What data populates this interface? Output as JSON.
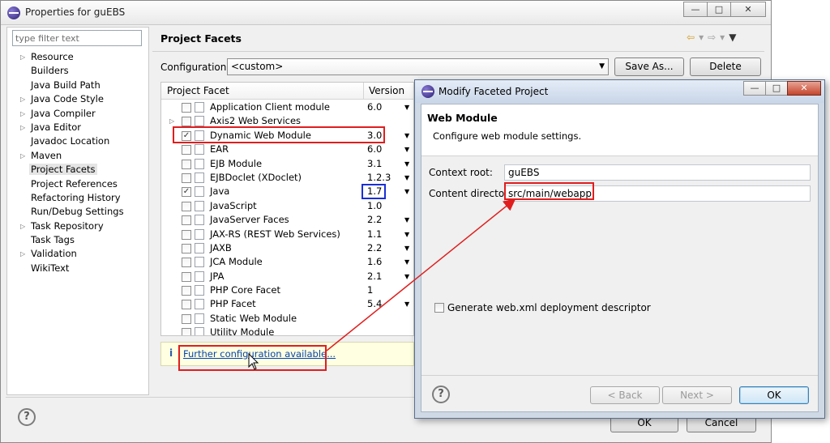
{
  "main_window": {
    "title": "Properties for guEBS",
    "controls": {
      "minimize": "—",
      "maximize": "□",
      "close": "✕"
    },
    "filter_placeholder": "type filter text",
    "nav": [
      {
        "label": "Resource",
        "expandable": true
      },
      {
        "label": "Builders",
        "expandable": false
      },
      {
        "label": "Java Build Path",
        "expandable": false
      },
      {
        "label": "Java Code Style",
        "expandable": true
      },
      {
        "label": "Java Compiler",
        "expandable": true
      },
      {
        "label": "Java Editor",
        "expandable": true
      },
      {
        "label": "Javadoc Location",
        "expandable": false
      },
      {
        "label": "Maven",
        "expandable": true
      },
      {
        "label": "Project Facets",
        "expandable": false,
        "selected": true
      },
      {
        "label": "Project References",
        "expandable": false
      },
      {
        "label": "Refactoring History",
        "expandable": false
      },
      {
        "label": "Run/Debug Settings",
        "expandable": false
      },
      {
        "label": "Task Repository",
        "expandable": true
      },
      {
        "label": "Task Tags",
        "expandable": false
      },
      {
        "label": "Validation",
        "expandable": true
      },
      {
        "label": "WikiText",
        "expandable": false
      }
    ],
    "page_title": "Project Facets",
    "configuration_label": "Configuration:",
    "configuration_value": "<custom>",
    "save_as_label": "Save As...",
    "delete_label": "Delete",
    "table_headers": {
      "facet": "Project Facet",
      "version": "Version"
    },
    "facets": [
      {
        "name": "Application Client module",
        "version": "6.0",
        "checked": false,
        "has_dropdown": true,
        "expander": false
      },
      {
        "name": "Axis2 Web Services",
        "version": "",
        "checked": false,
        "has_dropdown": false,
        "expander": true
      },
      {
        "name": "Dynamic Web Module",
        "version": "3.0",
        "checked": true,
        "has_dropdown": true,
        "expander": false
      },
      {
        "name": "EAR",
        "version": "6.0",
        "checked": false,
        "has_dropdown": true,
        "expander": false
      },
      {
        "name": "EJB Module",
        "version": "3.1",
        "checked": false,
        "has_dropdown": true,
        "expander": false
      },
      {
        "name": "EJBDoclet (XDoclet)",
        "version": "1.2.3",
        "checked": false,
        "has_dropdown": true,
        "expander": false
      },
      {
        "name": "Java",
        "version": "1.7",
        "checked": true,
        "has_dropdown": true,
        "expander": false
      },
      {
        "name": "JavaScript",
        "version": "1.0",
        "checked": false,
        "has_dropdown": false,
        "expander": false
      },
      {
        "name": "JavaServer Faces",
        "version": "2.2",
        "checked": false,
        "has_dropdown": true,
        "expander": false
      },
      {
        "name": "JAX-RS (REST Web Services)",
        "version": "1.1",
        "checked": false,
        "has_dropdown": true,
        "expander": false
      },
      {
        "name": "JAXB",
        "version": "2.2",
        "checked": false,
        "has_dropdown": true,
        "expander": false
      },
      {
        "name": "JCA Module",
        "version": "1.6",
        "checked": false,
        "has_dropdown": true,
        "expander": false
      },
      {
        "name": "JPA",
        "version": "2.1",
        "checked": false,
        "has_dropdown": true,
        "expander": false
      },
      {
        "name": "PHP Core Facet",
        "version": "1",
        "checked": false,
        "has_dropdown": false,
        "expander": false
      },
      {
        "name": "PHP Facet",
        "version": "5.4",
        "checked": false,
        "has_dropdown": true,
        "expander": false
      },
      {
        "name": "Static Web Module",
        "version": "",
        "checked": false,
        "has_dropdown": false,
        "expander": false
      },
      {
        "name": "Utility Module",
        "version": "",
        "checked": false,
        "has_dropdown": false,
        "expander": false
      }
    ],
    "info_link": "Further configuration available...",
    "hidden_ok_label": "OK",
    "hidden_cancel_label": "Cancel"
  },
  "dialog": {
    "title": "Modify Faceted Project",
    "controls": {
      "minimize": "—",
      "maximize": "□",
      "close": "✕"
    },
    "heading": "Web Module",
    "description": "Configure web module settings.",
    "context_root_label": "Context root:",
    "context_root_value": "guEBS",
    "content_dir_label": "Content directory:",
    "content_dir_value": "src/main/webapp",
    "generate_label": "Generate web.xml deployment descriptor",
    "back_label": "< Back",
    "next_label": "Next >",
    "ok_label": "OK"
  },
  "colors": {
    "annotation_red": "#e01e1e",
    "annotation_blue": "#1a2fd6",
    "link": "#0645ad",
    "info_background": "#ffffe1"
  }
}
